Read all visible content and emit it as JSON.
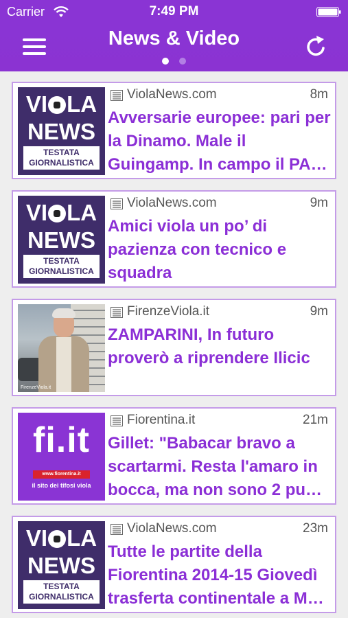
{
  "status_bar": {
    "carrier": "Carrier",
    "time": "7:49 PM"
  },
  "nav": {
    "title": "News & Video",
    "page_count": 2,
    "active_page": 1
  },
  "logos": {
    "violanews": {
      "line1a": "VI",
      "line1b": "LA",
      "line2": "NEWS",
      "box1": "TESTATA",
      "box2": "GIORNALISTICA"
    },
    "fiit": {
      "text": "fi.it",
      "url": "www.fiorentina.it",
      "tagline": "il sito dei tifosi viola"
    },
    "photo_caption": "FirenzeViola.it"
  },
  "articles": [
    {
      "source": "ViolaNews.com",
      "age": "8m",
      "headline": "Avversarie europee: pari per la Dinamo. Male il Guingamp. In campo il PA…",
      "thumb": "violanews"
    },
    {
      "source": "ViolaNews.com",
      "age": "9m",
      "headline": "Amici viola un po’ di pazienza con tecnico e squadra",
      "thumb": "violanews"
    },
    {
      "source": "FirenzeViola.it",
      "age": "9m",
      "headline": "ZAMPARINI, In futuro proverò a riprendere Ilicic",
      "thumb": "photo"
    },
    {
      "source": "Fiorentina.it",
      "age": "21m",
      "headline": "Gillet: \"Babacar bravo a scartarmi. Resta l'amaro in bocca, ma non sono 2 pu…",
      "thumb": "fiit"
    },
    {
      "source": "ViolaNews.com",
      "age": "23m",
      "headline": "Tutte le partite della Fiorentina 2014-15  Giovedì trasferta continentale a M…",
      "thumb": "violanews"
    }
  ],
  "colors": {
    "accent": "#8a34d4",
    "headline": "#8b2fd6",
    "card_border": "#c49be8",
    "background": "#eeeeee"
  }
}
